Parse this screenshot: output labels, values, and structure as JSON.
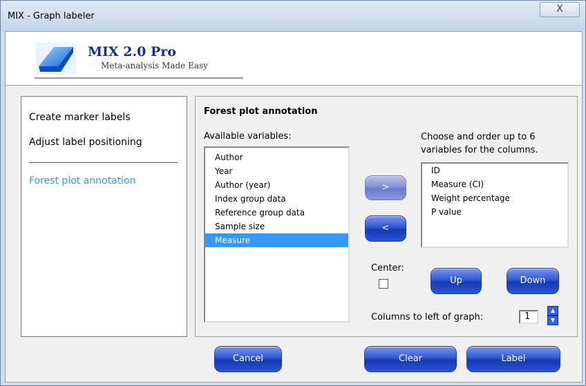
{
  "window": {
    "title": "MIX - Graph labeler",
    "close_glyph": "X"
  },
  "banner": {
    "product": "MIX 2.0 Pro",
    "tagline": "Meta-analysis Made Easy",
    "logo_icon": "mix-logo-icon"
  },
  "nav": {
    "items": [
      {
        "label": "Create marker labels"
      },
      {
        "label": "Adjust label positioning"
      },
      {
        "label": "Forest plot annotation"
      }
    ]
  },
  "panel": {
    "heading": "Forest plot annotation",
    "available_label": "Available variables:",
    "choose_label": "Choose  and order up to 6 variables for the columns.",
    "available": [
      "Author",
      "Year",
      "Author (year)",
      "Index group data",
      "Reference group data",
      "Sample size",
      "Measure"
    ],
    "selected_available": "Measure",
    "chosen": [
      "ID",
      "Measure (CI)",
      "Weight percentage",
      "P value"
    ],
    "add_label": ">",
    "remove_label": "<",
    "center_label": "Center:",
    "center_checked": false,
    "up_label": "Up",
    "down_label": "Down",
    "cols_label": "Columns to left of graph:",
    "cols_value": "1",
    "spin_up_glyph": "▲",
    "spin_down_glyph": "▼"
  },
  "footer": {
    "cancel_label": "Cancel",
    "clear_label": "Clear",
    "label_label": "Label"
  },
  "colors": {
    "active_nav": "#3b9ae0",
    "selection": "#3399ff",
    "button_blue": "#2f57d3"
  }
}
